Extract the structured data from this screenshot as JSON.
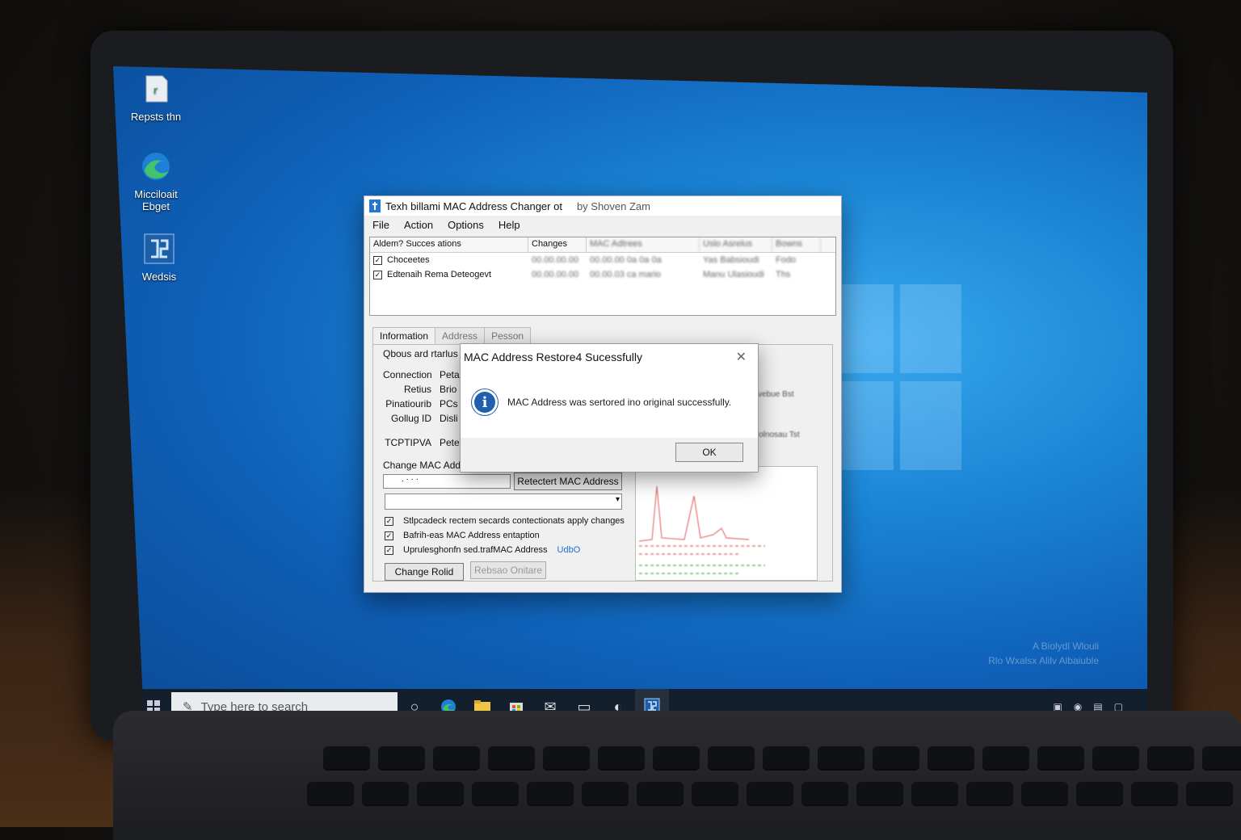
{
  "desktop": {
    "icons": [
      {
        "label": "Repsts thn"
      },
      {
        "label": "Micciloait Ebget"
      },
      {
        "label": "Wedsis"
      }
    ],
    "watermark_lines": [
      "A Biolydl Wlouli",
      "Rlo Wxalsx Alilv Albaiuble"
    ]
  },
  "taskbar": {
    "search_placeholder": "Type here to search"
  },
  "app": {
    "title": "Texh billami MAC Address Changer ot",
    "byline": "by Shoven Zam",
    "menu": [
      "File",
      "Action",
      "Options",
      "Help"
    ],
    "list": {
      "columns": [
        "Aldem? Succes ations",
        "Changes",
        "MAC Adtrees",
        "Uslo Asrelus",
        "Bowns"
      ],
      "rows": [
        {
          "checked": true,
          "name": "Choceetes",
          "changes": "00.00.00.00",
          "mac": "00.00.00 0a 0a 0a",
          "col4": "Yas Babsioudi",
          "col5": "Fodo"
        },
        {
          "checked": true,
          "name": "Edtenaih Rema Deteogevt",
          "changes": "00.00.00.00",
          "mac": "00.00.03 ca mario",
          "col4": "Manu Ulasioudi",
          "col5": "Ths"
        }
      ]
    },
    "tabs": [
      "Information",
      "Address",
      "Pesson"
    ],
    "panel": {
      "group_label": "Qbous ard rtarlus",
      "fields": [
        {
          "key": "Connection",
          "value": "Peta"
        },
        {
          "key": "Retius",
          "value": "Brio"
        },
        {
          "key": "Pinatiourib",
          "value": "PCs"
        },
        {
          "key": "Gollug ID",
          "value": "Disli"
        },
        {
          "key": "TCPTIPVA",
          "value": "Pete"
        }
      ],
      "change_label": "Change MAC Addr",
      "mac_input_value": ". · · ·",
      "restore_button": "Retectert MAC Address",
      "options": [
        {
          "checked": true,
          "label": "Stlpcadeck rectem secards contectionats apply changes"
        },
        {
          "checked": true,
          "label": "Bafrih-eas MAC Address entaption"
        },
        {
          "checked": true,
          "label": "Uprulesghonfn sed.trafMAC Address",
          "link": "UdbO"
        }
      ],
      "change_button": "Change Rolid",
      "disabled_button": "Rebsao Onitare",
      "side_texts": [
        "Yvebue Bst",
        "Uolnosau Tst"
      ]
    }
  },
  "dialog": {
    "title": "MAC Address Restore4 Sucessfully",
    "message": "MAC Address was sertored ino original successfully.",
    "ok_label": "OK",
    "info_glyph": "i"
  }
}
